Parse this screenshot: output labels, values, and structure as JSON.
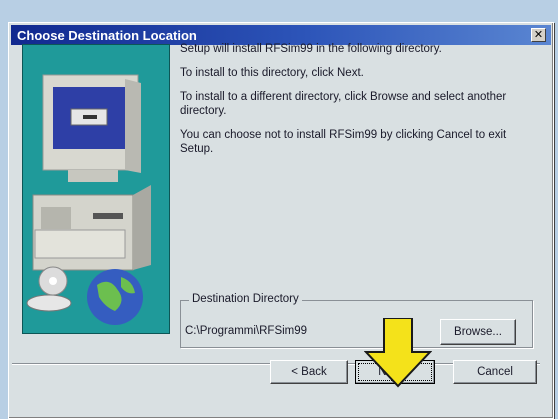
{
  "window": {
    "title": "Choose Destination Location",
    "close_glyph": "✕"
  },
  "body": {
    "line1": "Setup will install RFSim99 in the following directory.",
    "line2": "To install to this directory, click Next.",
    "line3": "To install to a different directory, click Browse and select another directory.",
    "line4": "You can choose not to install RFSim99 by clicking Cancel to exit Setup."
  },
  "destination": {
    "group_label": "Destination Directory",
    "path": "C:\\Programmi\\RFSim99",
    "browse_label": "Browse..."
  },
  "buttons": {
    "back_label": "< Back",
    "next_label": "Next >",
    "cancel_label": "Cancel"
  },
  "colors": {
    "titlebar_start": "#11298f",
    "titlebar_end": "#5a86d2",
    "dialog_bg": "#d9e0e2",
    "artwork_bg": "#1f9a9a",
    "highlight_arrow": "#f4e21a"
  },
  "icons": {
    "artwork": "computer-with-cd-and-globe-illustration",
    "annotation": "down-arrow-icon"
  }
}
